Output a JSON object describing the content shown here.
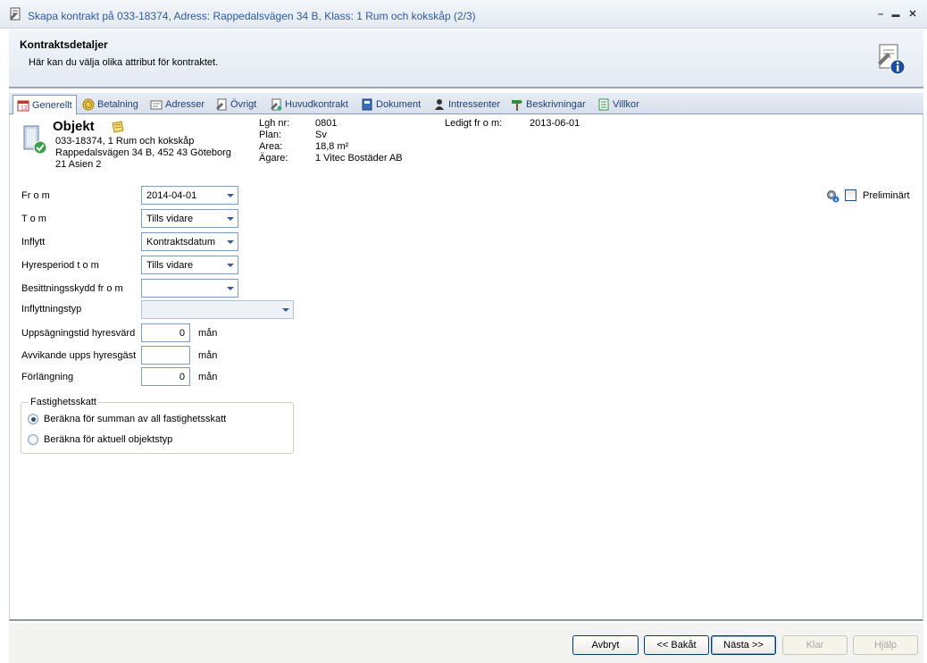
{
  "window": {
    "title": "Skapa kontrakt på 033-18374, Adress: Rappedalsvägen 34 B, Klass: 1 Rum och kokskåp (2/3)",
    "minimize": "–",
    "maximize": "▬",
    "close": "✕"
  },
  "header": {
    "title": "Kontraktsdetaljer",
    "subtitle": "Här kan du välja olika attribut för kontraktet."
  },
  "tabs": [
    {
      "label": "Generellt",
      "active": true
    },
    {
      "label": "Betalning"
    },
    {
      "label": "Adresser"
    },
    {
      "label": "Övrigt"
    },
    {
      "label": "Huvudkontrakt"
    },
    {
      "label": "Dokument"
    },
    {
      "label": "Intressenter"
    },
    {
      "label": "Beskrivningar"
    },
    {
      "label": "Villkor"
    }
  ],
  "object": {
    "title": "Objekt",
    "line1": "033-18374,  1 Rum och kokskåp",
    "line2": "Rappedalsvägen 34 B, 452 43 Göteborg",
    "line3": "21 Asien 2",
    "fields": [
      {
        "label": "Lgh nr:",
        "value": "0801"
      },
      {
        "label": "Plan:",
        "value": "Sv"
      },
      {
        "label": "Area:",
        "value": "18,8 m²"
      },
      {
        "label": "Ägare:",
        "value": "1 Vitec Bostäder AB"
      }
    ],
    "available_label": "Ledigt fr o m:",
    "available_value": "2013-06-01"
  },
  "form": {
    "from_label": "Fr o m",
    "from_value": "2014-04-01",
    "to_label": "T o m",
    "to_value": "Tills vidare",
    "move_in_label": "Inflytt",
    "move_in_value": "Kontraktsdatum",
    "rent_period_label": "Hyresperiod t o m",
    "rent_period_value": "Tills vidare",
    "protection_label": "Besittningsskydd fr o m",
    "protection_value": "",
    "move_in_type_label": "Inflyttningstyp",
    "move_in_type_value": "",
    "notice_landlord_label": "Uppsägningstid hyresvärd",
    "notice_landlord_value": "0",
    "notice_tenant_label": "Avvikande upps hyresgäst",
    "notice_tenant_value": "",
    "extension_label": "Förlängning",
    "extension_value": "0",
    "unit": "mån",
    "preliminary_label": "Preliminärt",
    "preliminary_checked": false
  },
  "tax": {
    "legend": "Fastighetsskatt",
    "option1": "Beräkna för summan av all fastighetsskatt",
    "option2": "Beräkna för aktuell objektstyp",
    "selected": 1
  },
  "buttons": {
    "cancel": "Avbryt",
    "back": "<< Bakåt",
    "next": "Nästa >>",
    "finish": "Klar",
    "help": "Hjälp"
  }
}
